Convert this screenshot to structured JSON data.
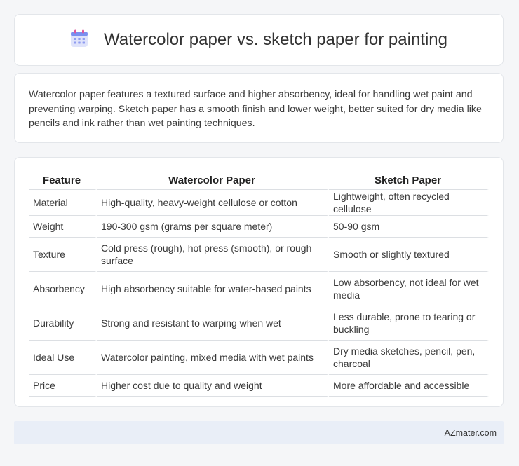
{
  "header": {
    "title": "Watercolor paper vs. sketch paper for painting",
    "icon": "calendar-icon"
  },
  "intro": {
    "text": "Watercolor paper features a textured surface and higher absorbency, ideal for handling wet paint and preventing warping. Sketch paper has a smooth finish and lower weight, better suited for dry media like pencils and ink rather than wet painting techniques."
  },
  "table": {
    "headers": [
      "Feature",
      "Watercolor Paper",
      "Sketch Paper"
    ],
    "rows": [
      [
        "Material",
        "High-quality, heavy-weight cellulose or cotton",
        "Lightweight, often recycled cellulose"
      ],
      [
        "Weight",
        "190-300 gsm (grams per square meter)",
        "50-90 gsm"
      ],
      [
        "Texture",
        "Cold press (rough), hot press (smooth), or rough surface",
        "Smooth or slightly textured"
      ],
      [
        "Absorbency",
        "High absorbency suitable for water-based paints",
        "Low absorbency, not ideal for wet media"
      ],
      [
        "Durability",
        "Strong and resistant to warping when wet",
        "Less durable, prone to tearing or buckling"
      ],
      [
        "Ideal Use",
        "Watercolor painting, mixed media with wet paints",
        "Dry media sketches, pencil, pen, charcoal"
      ],
      [
        "Price",
        "Higher cost due to quality and weight",
        "More affordable and accessible"
      ]
    ]
  },
  "footer": {
    "text": "AZmater.com"
  }
}
